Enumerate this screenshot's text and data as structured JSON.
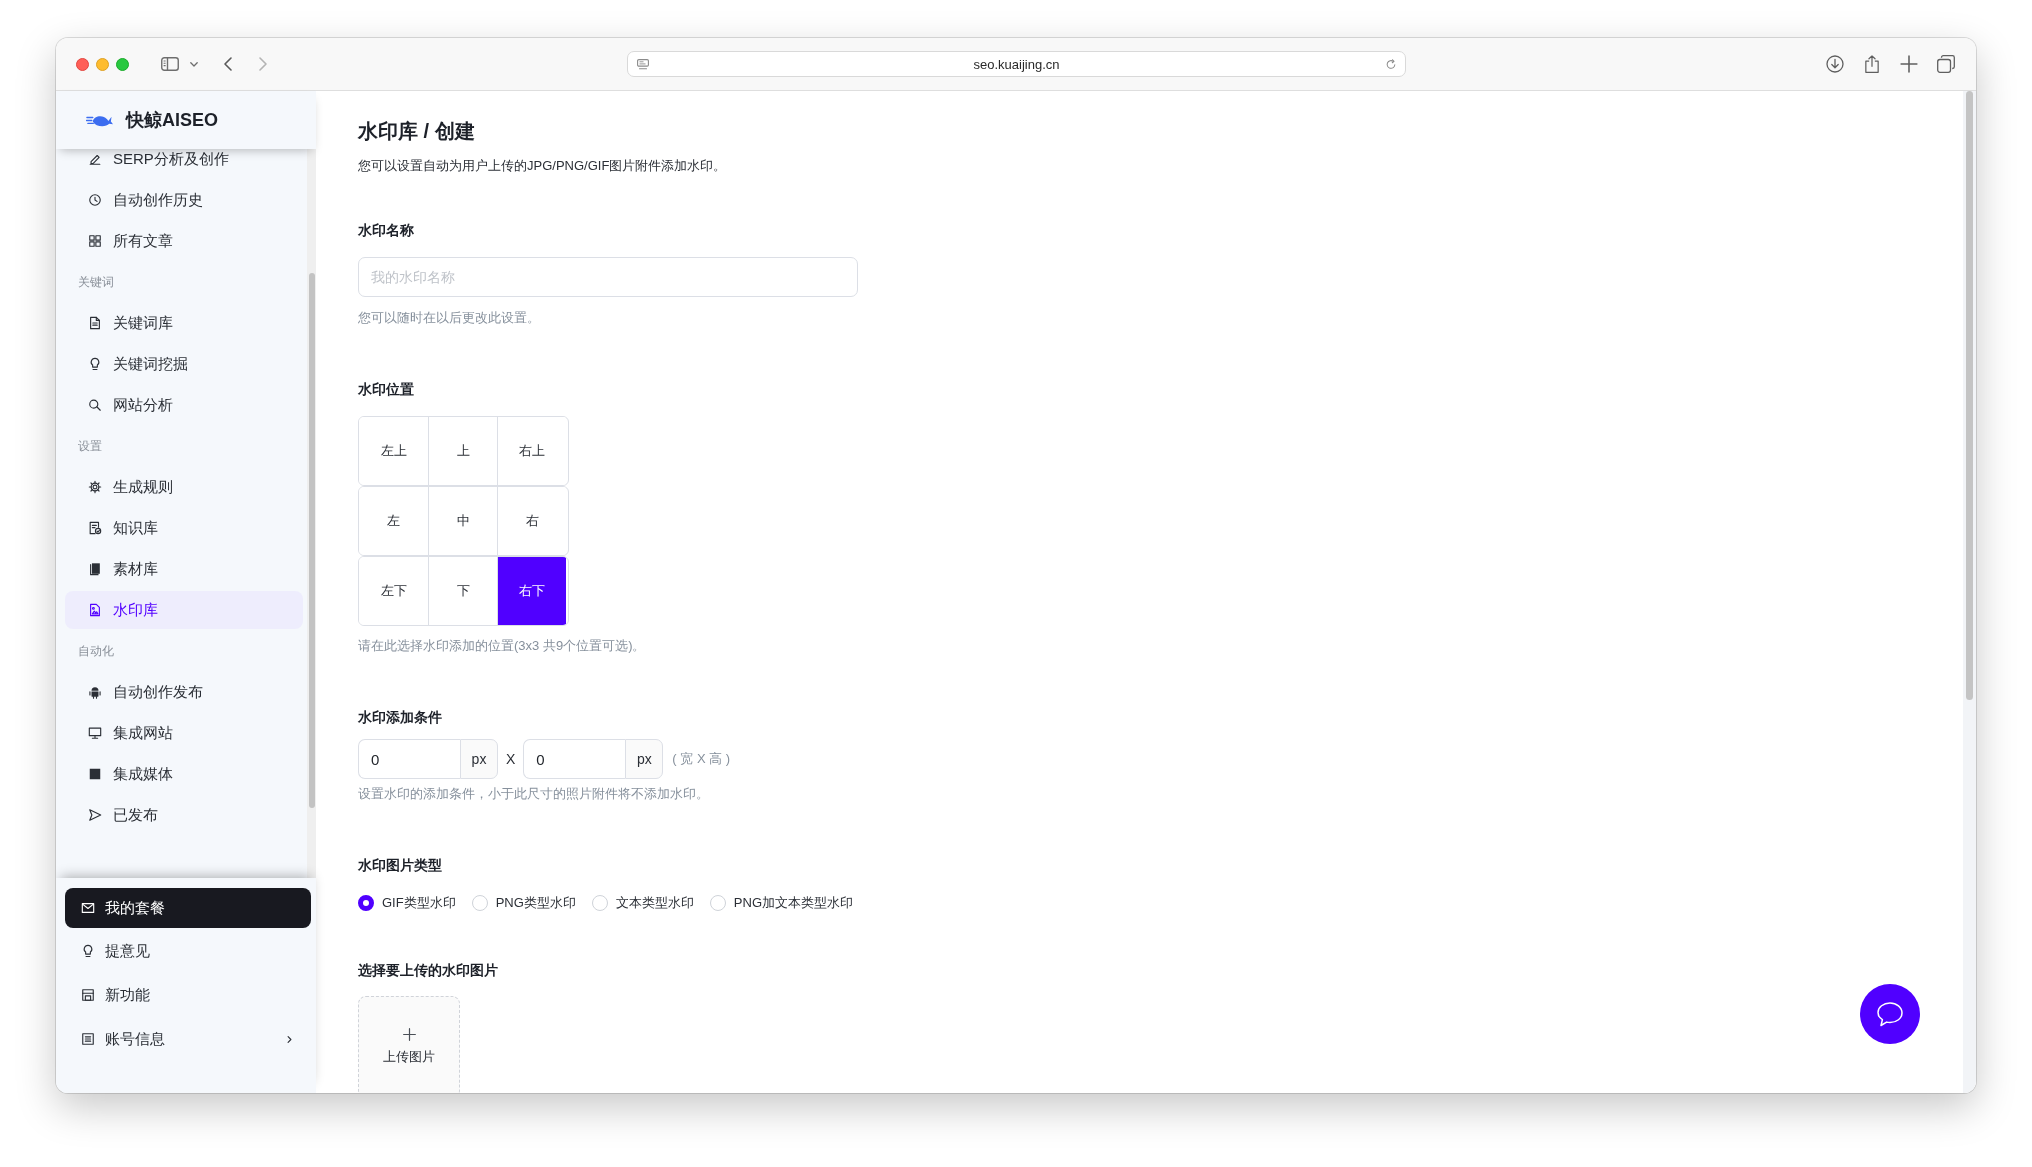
{
  "browser": {
    "url": "seo.kuaijing.cn"
  },
  "sidebar": {
    "brand": "快鲸AISEO",
    "groups": [
      {
        "items": [
          {
            "label": "SERP分析及创作",
            "selected": false
          },
          {
            "label": "自动创作历史",
            "selected": false
          },
          {
            "label": "所有文章",
            "selected": false
          }
        ]
      },
      {
        "title": "关键词",
        "items": [
          {
            "label": "关键词库",
            "selected": false
          },
          {
            "label": "关键词挖掘",
            "selected": false
          },
          {
            "label": "网站分析",
            "selected": false
          }
        ]
      },
      {
        "title": "设置",
        "items": [
          {
            "label": "生成规则",
            "selected": false
          },
          {
            "label": "知识库",
            "selected": false
          },
          {
            "label": "素材库",
            "selected": false
          },
          {
            "label": "水印库",
            "selected": true
          }
        ]
      },
      {
        "title": "自动化",
        "items": [
          {
            "label": "自动创作发布",
            "selected": false
          },
          {
            "label": "集成网站",
            "selected": false
          },
          {
            "label": "集成媒体",
            "selected": false
          },
          {
            "label": "已发布",
            "selected": false
          }
        ]
      }
    ],
    "footer": [
      {
        "label": "我的套餐",
        "kind": "primary"
      },
      {
        "label": "提意见",
        "kind": "plain"
      },
      {
        "label": "新功能",
        "kind": "plain"
      },
      {
        "label": "账号信息",
        "kind": "submenu"
      }
    ]
  },
  "page": {
    "title": "水印库 / 创建",
    "description": "您可以设置自动为用户上传的JPG/PNG/GIF图片附件添加水印。"
  },
  "name_field": {
    "label": "水印名称",
    "placeholder": "我的水印名称",
    "help": "您可以随时在以后更改此设置。"
  },
  "position": {
    "label": "水印位置",
    "cells": [
      {
        "label": "左上",
        "selected": false
      },
      {
        "label": "上",
        "selected": false
      },
      {
        "label": "右上",
        "selected": false
      },
      {
        "label": "左",
        "selected": false
      },
      {
        "label": "中",
        "selected": false
      },
      {
        "label": "右",
        "selected": false
      },
      {
        "label": "左下",
        "selected": false
      },
      {
        "label": "下",
        "selected": false
      },
      {
        "label": "右下",
        "selected": true
      }
    ],
    "help": "请在此选择水印添加的位置(3x3 共9个位置可选)。"
  },
  "size_condition": {
    "label": "水印添加条件",
    "width": {
      "value": "0",
      "unit": "px"
    },
    "separator": "X",
    "height": {
      "value": "0",
      "unit": "px"
    },
    "note": "( 宽 X 高 )",
    "help": "设置水印的添加条件，小于此尺寸的照片附件将不添加水印。"
  },
  "image_type": {
    "label": "水印图片类型",
    "options": [
      {
        "label": "GIF类型水印",
        "selected": true
      },
      {
        "label": "PNG类型水印",
        "selected": false
      },
      {
        "label": "文本类型水印",
        "selected": false
      },
      {
        "label": "PNG加文本类型水印",
        "selected": false
      }
    ]
  },
  "upload": {
    "label": "选择要上传的水印图片",
    "button": "上传图片"
  }
}
